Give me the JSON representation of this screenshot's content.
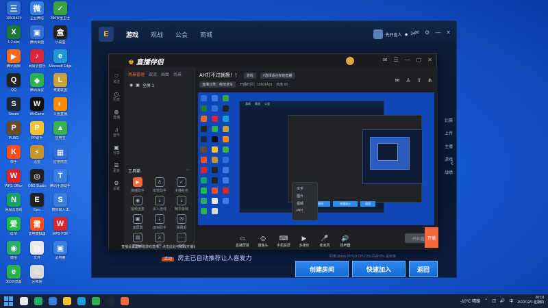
{
  "desktop": {
    "icons": [
      {
        "label": "10501423",
        "color": "#2f6fd6",
        "glyph": "三"
      },
      {
        "label": "企业微信",
        "color": "#3a7fe0",
        "glyph": "微"
      },
      {
        "label": "360安全卫士",
        "color": "#3aa345",
        "glyph": "✓"
      },
      {
        "label": "1-2.xlsx",
        "color": "#1d7a3b",
        "glyph": "X"
      },
      {
        "label": "腾讯桌面",
        "color": "#2f6fd6",
        "glyph": "▣"
      },
      {
        "label": "小黑盒",
        "color": "#222",
        "glyph": "盒"
      },
      {
        "label": "腾讯视频",
        "color": "#ff6a1a",
        "glyph": "▶"
      },
      {
        "label": "网易云音乐",
        "color": "#d7263d",
        "glyph": "♪"
      },
      {
        "label": "Microsoft Edge",
        "color": "#1f9ad6",
        "glyph": "e"
      },
      {
        "label": "QQ",
        "color": "#222",
        "glyph": "Q"
      },
      {
        "label": "腾讯会议",
        "color": "#2bb24c",
        "glyph": "◆"
      },
      {
        "label": "英雄联盟",
        "color": "#caa23a",
        "glyph": "L"
      },
      {
        "label": "Steam",
        "color": "#1b2838",
        "glyph": "S"
      },
      {
        "label": "WeGame",
        "color": "#111",
        "glyph": "W"
      },
      {
        "label": "斗鱼直播",
        "color": "#ff8a00",
        "glyph": "◐"
      },
      {
        "label": "PUBG",
        "color": "#6b4a2a",
        "glyph": "P"
      },
      {
        "label": "PP助手",
        "color": "#f4c133",
        "glyph": "P"
      },
      {
        "label": "应用宝",
        "color": "#37b24d",
        "glyph": "▲"
      },
      {
        "label": "快手",
        "color": "#ff4f1f",
        "glyph": "K"
      },
      {
        "label": "迅雷",
        "color": "#c7932b",
        "glyph": "⚡"
      },
      {
        "label": "应用商店",
        "color": "#2f6fd6",
        "glyph": "▦"
      },
      {
        "label": "WPS Office",
        "color": "#d9262b",
        "glyph": "W"
      },
      {
        "label": "OBS Studio",
        "color": "#222",
        "glyph": "◎"
      },
      {
        "label": "腾讯手游助手",
        "color": "#3a7fe0",
        "glyph": "T"
      },
      {
        "label": "网易云游戏",
        "color": "#1aa260",
        "glyph": "N"
      },
      {
        "label": "Epic",
        "color": "#222",
        "glyph": "E"
      },
      {
        "label": "搜狗输入法",
        "color": "#3a7fe0",
        "glyph": "S"
      },
      {
        "label": "iQIYI",
        "color": "#1fbf45",
        "glyph": "爱"
      },
      {
        "label": "雷电模拟器",
        "color": "#ff4f1f",
        "glyph": "雷"
      },
      {
        "label": "WPS PDF",
        "color": "#d9262b",
        "glyph": "W"
      },
      {
        "label": "微信",
        "color": "#2aae67",
        "glyph": "◉"
      },
      {
        "label": "文件",
        "color": "#e8e8e8",
        "glyph": "▤"
      },
      {
        "label": "此电脑",
        "color": "#3a7fe0",
        "glyph": "▣"
      },
      {
        "label": "360浏览器",
        "color": "#2bb24c",
        "glyph": "e"
      },
      {
        "label": "回收站",
        "color": "#d9d9d9",
        "glyph": "♲"
      }
    ]
  },
  "client": {
    "logo_glyph": "E",
    "tabs": [
      {
        "label": "游戏",
        "active": true
      },
      {
        "label": "观战",
        "active": false
      },
      {
        "label": "公会",
        "active": false
      },
      {
        "label": "商城",
        "active": false
      }
    ],
    "user_name": "先开直人",
    "coins": "34",
    "side_items": [
      "比赛",
      "上传",
      "主播",
      "游戏",
      "战绩"
    ],
    "room_banner": "房主已自动推荐让人喜爱力",
    "room_tag": "活动",
    "buttons": {
      "create": "创建房间",
      "quick": "快速加入",
      "back": "返回"
    }
  },
  "stream": {
    "app_name": "直播伴侣",
    "rail": [
      {
        "glyph": "♡",
        "label": "关注"
      },
      {
        "glyph": "◷",
        "label": "历史"
      },
      {
        "glyph": "◍",
        "label": "直播"
      },
      {
        "glyph": "♫",
        "label": "音乐"
      },
      {
        "glyph": "▣",
        "label": "分享"
      },
      {
        "glyph": "☰",
        "label": "更多"
      },
      {
        "glyph": "⚙",
        "label": "设置"
      }
    ],
    "scene_tabs": [
      {
        "label": "场景管理",
        "on": true
      },
      {
        "label": "双流",
        "on": false
      },
      {
        "label": "画面",
        "on": false
      },
      {
        "label": "场景",
        "on": false
      }
    ],
    "scene_row": "全屏 1",
    "tools_title": "工具箱",
    "tools": [
      {
        "label": "直播助手",
        "glyph": "▶",
        "hot": true
      },
      {
        "label": "房管助手",
        "glyph": "♙",
        "hot": false
      },
      {
        "label": "主播任务",
        "glyph": "✓",
        "hot": false
      },
      {
        "label": "视频连麦",
        "glyph": "◉",
        "hot": false
      },
      {
        "label": "多人连线",
        "glyph": "⇣",
        "hot": false
      },
      {
        "label": "精华录制",
        "glyph": "⇣",
        "hot": false
      },
      {
        "label": "滚屏器",
        "glyph": "▣",
        "hot": false
      },
      {
        "label": "虚拟助手",
        "glyph": "⇣",
        "hot": false
      },
      {
        "label": "弹幕姬",
        "glyph": "✉",
        "hot": false
      },
      {
        "label": "直播间",
        "glyph": "▤",
        "hot": false
      },
      {
        "label": "PK",
        "glyph": "⚔",
        "hot": false
      },
      {
        "label": "更多",
        "glyph": "⋯",
        "hot": false
      }
    ],
    "notice": "直播设置里新增游戏直播，点击此处可修改开播设置",
    "stream_title": "AH打不过就撩！！",
    "title_chips": [
      "游戏",
      "#选择适合你的直播"
    ],
    "meta": [
      "直播分类：绝地求生",
      "开播时间：10501423",
      "热度 60"
    ],
    "stage_icons": [
      "✉",
      "♙",
      "⇪",
      "⋔"
    ],
    "context_menu": [
      "文字",
      "图片",
      "视频",
      "PPT"
    ],
    "controls": [
      {
        "glyph": "▭",
        "label": "直播屏幕"
      },
      {
        "glyph": "◎",
        "label": "摄像头"
      },
      {
        "glyph": "⌨",
        "label": "手机投屏"
      },
      {
        "glyph": "▶",
        "label": "多媒体"
      },
      {
        "glyph": "🎤",
        "label": "麦克风"
      },
      {
        "glyph": "🔊",
        "label": "扬声器"
      }
    ],
    "start_label": "开始直播",
    "stats": "码率:0kbps   FPS:0   CPU:2%   内存:0%   丢帧率",
    "orange_tab": "开播"
  },
  "preview_mini": {
    "tabs": [
      "游戏",
      "观战",
      "公会"
    ],
    "buttons": [
      "创建房间",
      "快速加入",
      "返回"
    ]
  },
  "taskbar": {
    "weather": "-10°C 晴朗",
    "time": "20:10",
    "date": "2022/12/1 星期四",
    "lang": "中"
  }
}
